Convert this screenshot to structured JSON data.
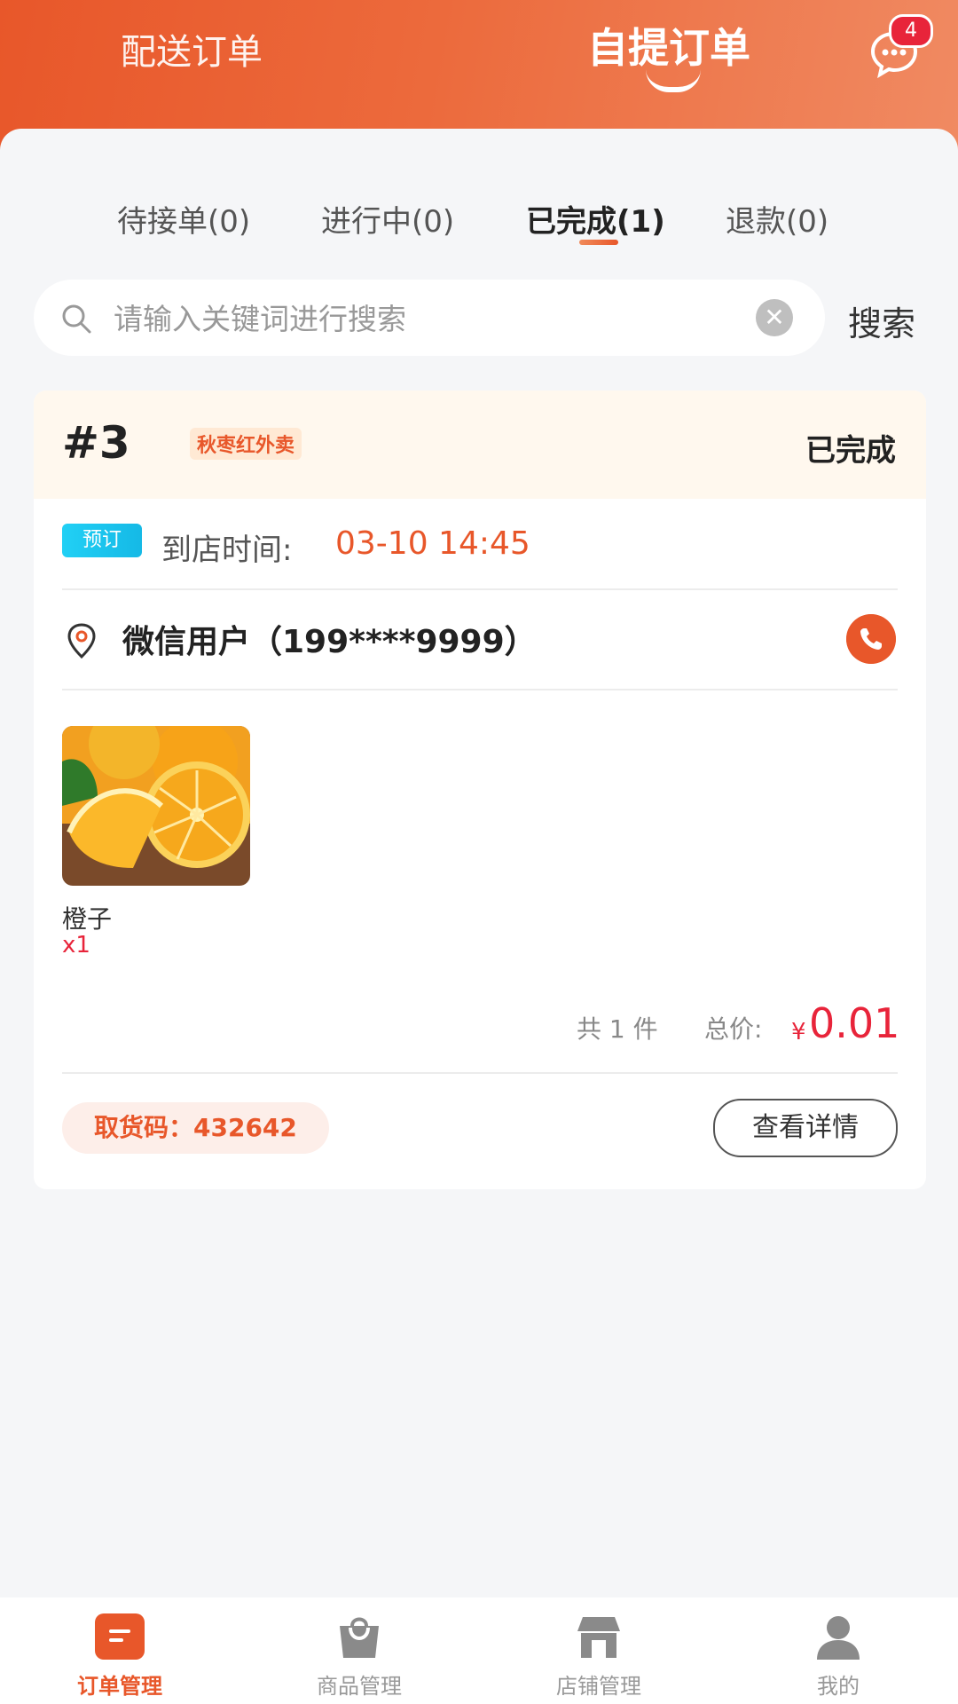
{
  "header": {
    "tab_delivery": "配送订单",
    "tab_pickup": "自提订单",
    "message_badge": "4"
  },
  "status_tabs": [
    {
      "label": "待接单(0)"
    },
    {
      "label": "进行中(0)"
    },
    {
      "label": "已完成(1)",
      "active": true
    },
    {
      "label": "退款(0)"
    }
  ],
  "search": {
    "placeholder": "请输入关键词进行搜索",
    "button_label": "搜索"
  },
  "order": {
    "number": "#3",
    "store": "秋枣红外卖",
    "status": "已完成",
    "reserve_tag": "预订",
    "arrive_label": "到店时间:",
    "arrive_time": "03-10 14:45",
    "customer": "微信用户（199****9999）",
    "product": {
      "name": "橙子",
      "qty": "x1"
    },
    "total_count": "共 1 件",
    "total_label": "总价:",
    "currency": "¥",
    "total_price": "0.01",
    "pickup_code": "取货码：432642",
    "detail_button": "查看详情"
  },
  "bottom_nav": [
    {
      "label": "订单管理",
      "icon": "order-icon",
      "active": true
    },
    {
      "label": "商品管理",
      "icon": "bag-icon"
    },
    {
      "label": "店铺管理",
      "icon": "store-icon"
    },
    {
      "label": "我的",
      "icon": "user-icon"
    }
  ],
  "colors": {
    "brand": "#e8572a",
    "price": "#e8243a",
    "reserve": "#15b9e6"
  }
}
